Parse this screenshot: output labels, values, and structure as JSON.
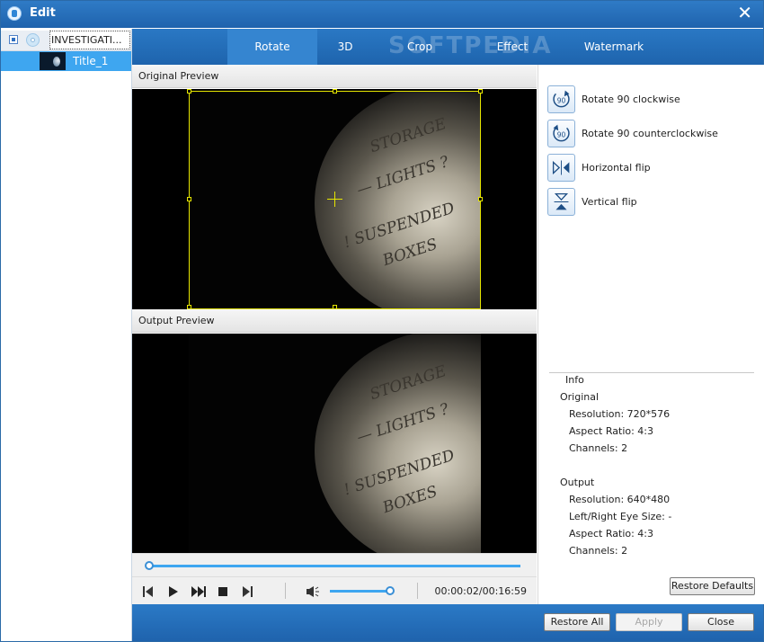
{
  "window": {
    "title": "Edit",
    "close_glyph": "✕",
    "app_icon": "app-icon"
  },
  "tree": {
    "disc_label": "INVESTIGATI...",
    "title_label": "Title_1"
  },
  "tabs": [
    {
      "label": "Rotate",
      "active": true
    },
    {
      "label": "3D",
      "active": false
    },
    {
      "label": "Crop",
      "active": false
    },
    {
      "label": "Effect",
      "active": false
    },
    {
      "label": "Watermark",
      "active": false
    }
  ],
  "watermark": "SOFTPEDIA",
  "original_preview": {
    "label": "Original Preview"
  },
  "output_preview": {
    "label": "Output Preview"
  },
  "video_scribbles": [
    "STORAGE",
    "— LIGHTS ?",
    "! SUSPENDED",
    "BOXES"
  ],
  "player": {
    "time": "00:00:02/00:16:59",
    "progress_fraction": 0.002,
    "volume_fraction": 0.95
  },
  "rotate_ops": [
    {
      "label": "Rotate 90 clockwise",
      "icon": "rotate-cw-icon",
      "badge": "90"
    },
    {
      "label": "Rotate 90 counterclockwise",
      "icon": "rotate-ccw-icon",
      "badge": "90"
    },
    {
      "label": "Horizontal flip",
      "icon": "flip-horizontal-icon"
    },
    {
      "label": "Vertical flip",
      "icon": "flip-vertical-icon"
    }
  ],
  "info": {
    "title": "Info",
    "original": {
      "heading": "Original",
      "resolution": "Resolution: 720*576",
      "aspect": "Aspect Ratio: 4:3",
      "channels": "Channels: 2"
    },
    "output": {
      "heading": "Output",
      "resolution": "Resolution: 640*480",
      "eye_size": "Left/Right Eye Size: -",
      "aspect": "Aspect Ratio: 4:3",
      "channels": "Channels: 2"
    }
  },
  "buttons": {
    "restore_defaults": "Restore Defaults",
    "restore_all": "Restore All",
    "apply": "Apply",
    "close": "Close"
  },
  "colors": {
    "accent": "#3ea6f0",
    "titlebar": "#2a72bd",
    "crop_frame": "#e6e600"
  }
}
